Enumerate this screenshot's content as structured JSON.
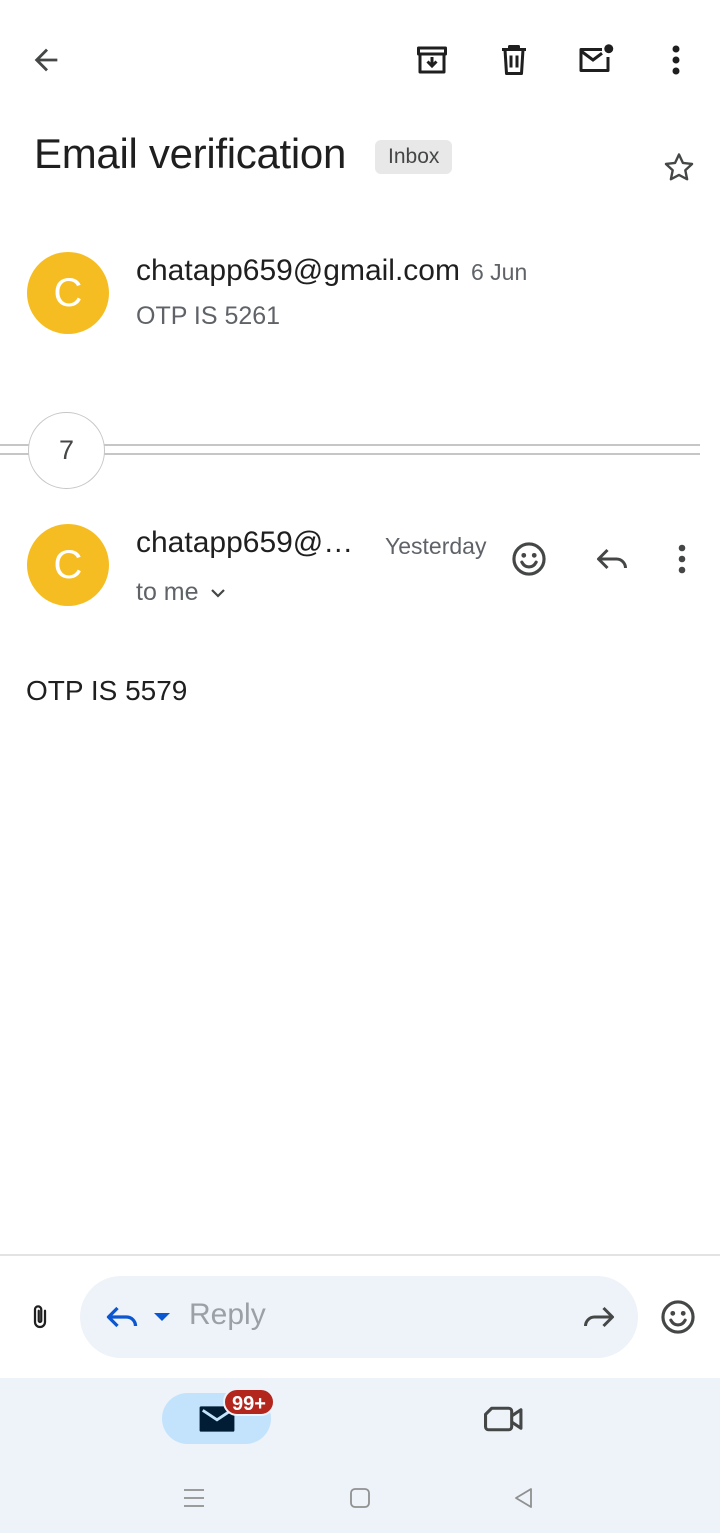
{
  "toolbar": {
    "back_icon": "arrow-back-icon",
    "archive_icon": "archive-icon",
    "delete_icon": "trash-icon",
    "mark_unread_icon": "mail-unread-icon",
    "more_icon": "more-vert-icon"
  },
  "thread": {
    "subject": "Email verification",
    "label_chip": "Inbox",
    "starred": false
  },
  "messages": [
    {
      "avatar_letter": "C",
      "avatar_color": "#f5bd22",
      "sender": "chatapp659@gmail.com",
      "date": "6 Jun",
      "snippet": "OTP IS 5261"
    },
    {
      "avatar_letter": "C",
      "avatar_color": "#f5bd22",
      "sender": "chatapp659@…",
      "date": "Yesterday",
      "recipient": "to me",
      "body": "OTP IS 5579"
    }
  ],
  "collapsed_count": "7",
  "reply_bar": {
    "placeholder": "Reply",
    "reply_icon_color": "#0b57d0"
  },
  "bottom_nav": {
    "mail_badge": "99+",
    "badge_color": "#b3261e",
    "active_pill_color": "#c2e3fb"
  }
}
